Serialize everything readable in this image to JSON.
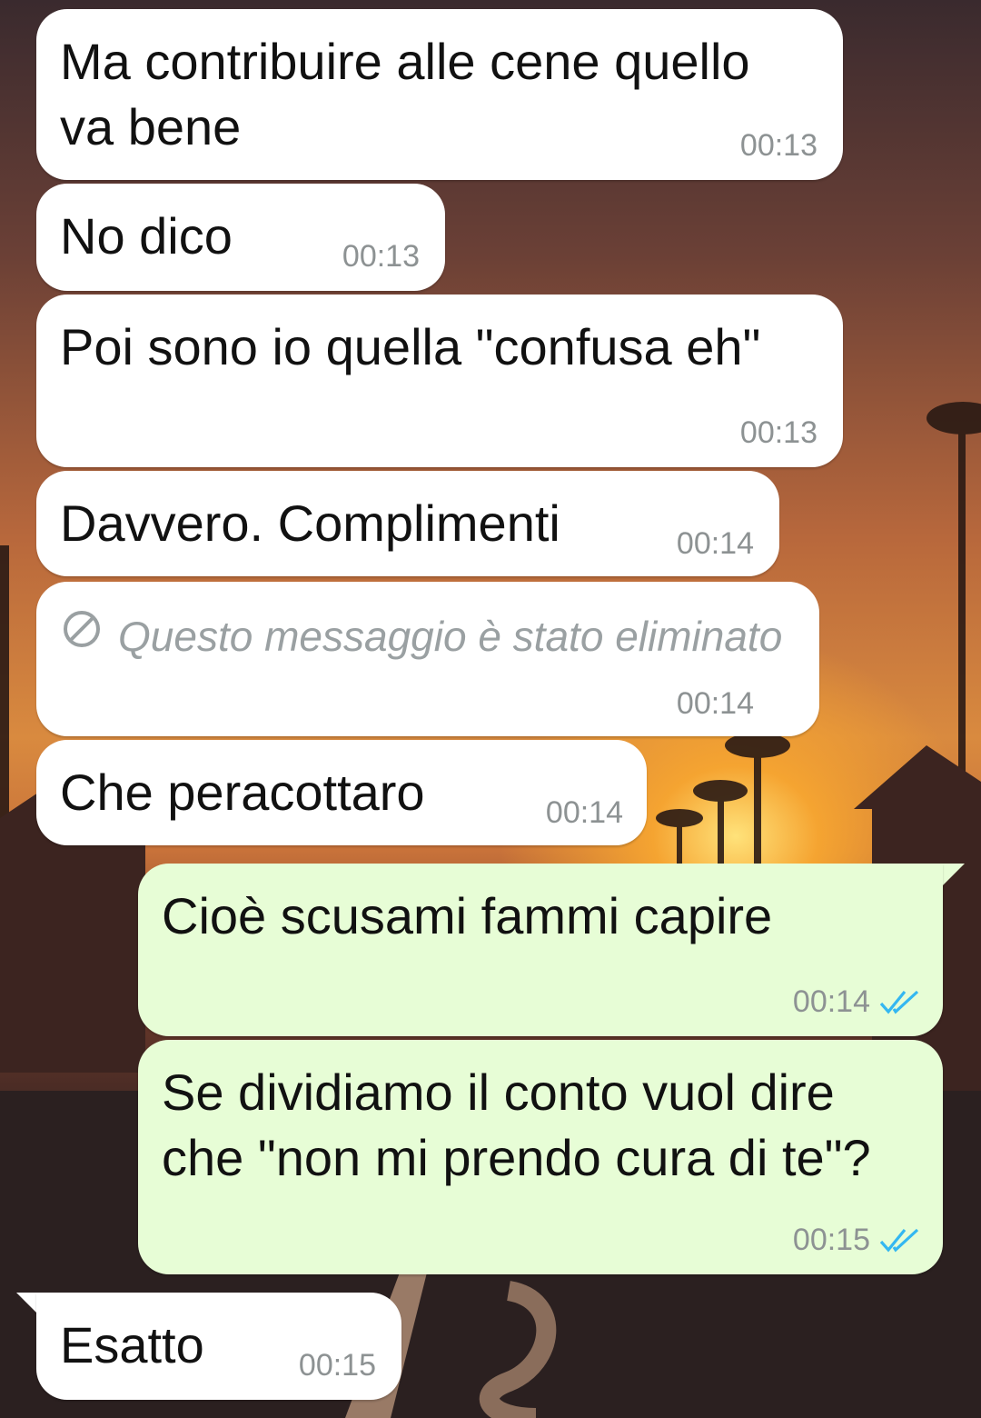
{
  "messages": [
    {
      "id": "m1",
      "direction": "incoming",
      "text": "Ma contribuire alle cene quello\nva bene",
      "time": "00:13"
    },
    {
      "id": "m2",
      "direction": "incoming",
      "text": "No dico",
      "time": "00:13"
    },
    {
      "id": "m3",
      "direction": "incoming",
      "text": "Poi sono io quella \"confusa eh\"",
      "time": "00:13"
    },
    {
      "id": "m4",
      "direction": "incoming",
      "text": "Davvero. Complimenti",
      "time": "00:14"
    },
    {
      "id": "m5",
      "direction": "incoming",
      "deleted": true,
      "text": "Questo messaggio è stato eliminato",
      "time": "00:14",
      "icon": "deleted-message-icon"
    },
    {
      "id": "m6",
      "direction": "incoming",
      "text": "Che peracottaro",
      "time": "00:14"
    },
    {
      "id": "m7",
      "direction": "outgoing",
      "text": "Cioè scusami fammi capire",
      "time": "00:14",
      "status": "read",
      "status_icon": "double-check-icon"
    },
    {
      "id": "m8",
      "direction": "outgoing",
      "text": "Se dividiamo il conto vuol dire\nche \"non mi prendo cura di te\"?",
      "time": "00:15",
      "status": "read",
      "status_icon": "double-check-icon"
    },
    {
      "id": "m9",
      "direction": "incoming",
      "text": "Esatto",
      "time": "00:15"
    }
  ],
  "colors": {
    "incoming_bubble": "#ffffff",
    "outgoing_bubble": "#e7fdd6",
    "read_ticks": "#34b7f1",
    "time_text": "#8d9293"
  }
}
